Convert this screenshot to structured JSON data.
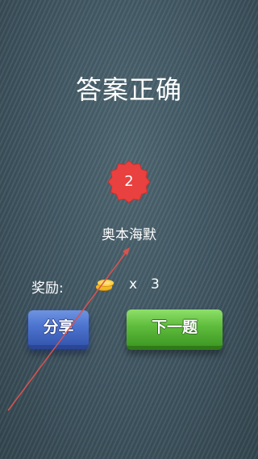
{
  "result": {
    "title": "答案正确"
  },
  "level": {
    "number": "2",
    "badge_color": "#e8413f"
  },
  "answer": {
    "text": "奥本海默"
  },
  "reward": {
    "label": "奖励:",
    "icon": "coin-stack-icon",
    "multiplier": "x",
    "count": "3"
  },
  "buttons": {
    "share_label": "分享",
    "next_label": "下一题"
  },
  "colors": {
    "background": "#3f5560",
    "share_button": "#4c74cf",
    "next_button": "#5fbd3d",
    "annotation_arrow": "#d9534f"
  }
}
